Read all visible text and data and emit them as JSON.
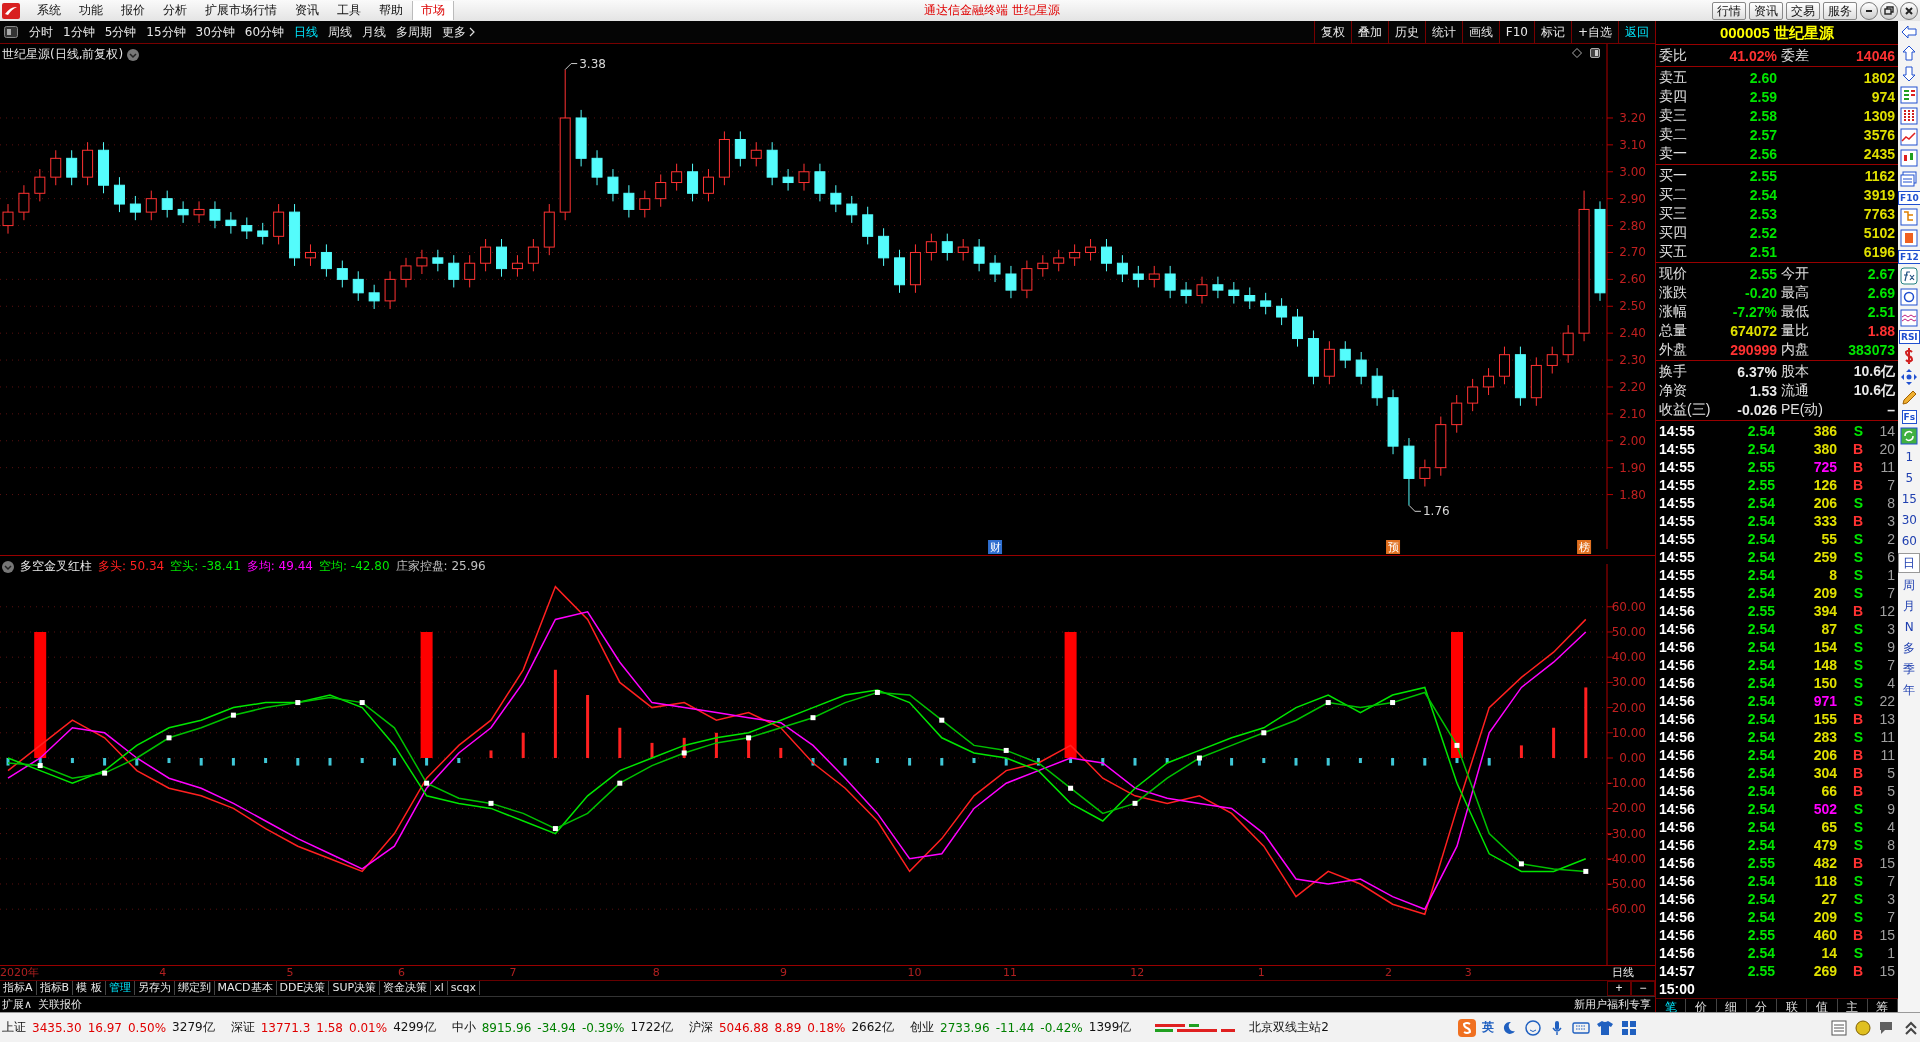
{
  "title_bar": {
    "menu": [
      {
        "label": "系统"
      },
      {
        "label": "功能"
      },
      {
        "label": "报价"
      },
      {
        "label": "分析"
      },
      {
        "label": "扩展市场行情"
      },
      {
        "label": "资讯"
      },
      {
        "label": "工具"
      },
      {
        "label": "帮助"
      }
    ],
    "market_tab": {
      "label": "市场",
      "selected": true
    },
    "title": "通达信金融终端  世纪星源",
    "buttons": [
      "行情",
      "资讯",
      "交易",
      "服务"
    ]
  },
  "toolbar": {
    "periods": [
      {
        "label": "分时",
        "selected": false
      },
      {
        "label": "1分钟",
        "selected": false
      },
      {
        "label": "5分钟",
        "selected": false
      },
      {
        "label": "15分钟",
        "selected": false
      },
      {
        "label": "30分钟",
        "selected": false
      },
      {
        "label": "60分钟",
        "selected": false
      },
      {
        "label": "日线",
        "selected": true
      },
      {
        "label": "周线",
        "selected": false
      },
      {
        "label": "月线",
        "selected": false
      },
      {
        "label": "多周期",
        "selected": false
      },
      {
        "label": "更多",
        "selected": false
      }
    ],
    "actions": [
      {
        "label": "复权",
        "accent": false
      },
      {
        "label": "叠加",
        "accent": false
      },
      {
        "label": "历史",
        "accent": false
      },
      {
        "label": "统计",
        "accent": false
      },
      {
        "label": "画线",
        "accent": false
      },
      {
        "label": "F10",
        "accent": false
      },
      {
        "label": "标记",
        "accent": false
      },
      {
        "label": "+自选",
        "accent": false
      },
      {
        "label": "返回",
        "accent": true
      }
    ]
  },
  "price_chart": {
    "title": "世纪星源(日线,前复权)",
    "markers": [
      {
        "label": "财",
        "color": "#2f6fd0"
      },
      {
        "label": "预",
        "color": "#e07020"
      },
      {
        "label": "榜",
        "color": "#e07020"
      }
    ],
    "axis_labels": [
      "2020年",
      "4",
      "5",
      "6",
      "7",
      "8",
      "9",
      "10",
      "11",
      "12",
      "1",
      "2",
      "3"
    ],
    "chart_data": {
      "type": "candlestick",
      "grid": true,
      "ylim": [
        1.598,
        3.475
      ],
      "yticks": [
        {
          "value": 3.2,
          "label": "3.20"
        },
        {
          "value": 3.1,
          "label": "3.10"
        },
        {
          "value": 3.0,
          "label": "3.00"
        },
        {
          "value": 2.9,
          "label": "2.90"
        },
        {
          "value": 2.8,
          "label": "2.80"
        },
        {
          "value": 2.7,
          "label": "2.70"
        },
        {
          "value": 2.6,
          "label": "2.60"
        },
        {
          "value": 2.5,
          "label": "2.50"
        },
        {
          "value": 2.4,
          "label": "2.40"
        },
        {
          "value": 2.3,
          "label": "2.30"
        },
        {
          "value": 2.2,
          "label": "2.20"
        },
        {
          "value": 2.1,
          "label": "2.10"
        },
        {
          "value": 2.0,
          "label": "2.00"
        },
        {
          "value": 1.9,
          "label": "1.90"
        },
        {
          "value": 1.8,
          "label": "1.80"
        }
      ],
      "annotations": [
        "3.38",
        "1.76"
      ],
      "ohlc": [
        [
          2.8,
          2.88,
          2.77,
          2.85
        ],
        [
          2.85,
          2.95,
          2.82,
          2.92
        ],
        [
          2.92,
          3.01,
          2.89,
          2.98
        ],
        [
          2.98,
          3.08,
          2.95,
          3.05
        ],
        [
          3.05,
          3.08,
          2.95,
          2.98
        ],
        [
          2.98,
          3.11,
          2.95,
          3.08
        ],
        [
          3.08,
          3.11,
          2.92,
          2.95
        ],
        [
          2.95,
          2.98,
          2.85,
          2.88
        ],
        [
          2.88,
          2.91,
          2.82,
          2.85
        ],
        [
          2.85,
          2.93,
          2.82,
          2.9
        ],
        [
          2.9,
          2.93,
          2.83,
          2.86
        ],
        [
          2.86,
          2.89,
          2.81,
          2.84
        ],
        [
          2.84,
          2.89,
          2.81,
          2.86
        ],
        [
          2.86,
          2.89,
          2.79,
          2.82
        ],
        [
          2.82,
          2.85,
          2.77,
          2.8
        ],
        [
          2.8,
          2.83,
          2.75,
          2.78
        ],
        [
          2.78,
          2.81,
          2.73,
          2.76
        ],
        [
          2.76,
          2.88,
          2.73,
          2.85
        ],
        [
          2.85,
          2.88,
          2.65,
          2.68
        ],
        [
          2.68,
          2.73,
          2.65,
          2.7
        ],
        [
          2.7,
          2.73,
          2.61,
          2.64
        ],
        [
          2.64,
          2.67,
          2.57,
          2.6
        ],
        [
          2.6,
          2.63,
          2.52,
          2.55
        ],
        [
          2.55,
          2.58,
          2.49,
          2.52
        ],
        [
          2.52,
          2.63,
          2.49,
          2.6
        ],
        [
          2.6,
          2.68,
          2.57,
          2.65
        ],
        [
          2.65,
          2.71,
          2.62,
          2.68
        ],
        [
          2.68,
          2.71,
          2.63,
          2.66
        ],
        [
          2.66,
          2.69,
          2.57,
          2.6
        ],
        [
          2.6,
          2.69,
          2.57,
          2.66
        ],
        [
          2.66,
          2.75,
          2.63,
          2.72
        ],
        [
          2.72,
          2.75,
          2.61,
          2.64
        ],
        [
          2.64,
          2.69,
          2.61,
          2.66
        ],
        [
          2.66,
          2.75,
          2.63,
          2.72
        ],
        [
          2.72,
          2.88,
          2.69,
          2.85
        ],
        [
          2.85,
          3.38,
          2.82,
          3.2
        ],
        [
          3.2,
          3.23,
          3.02,
          3.05
        ],
        [
          3.05,
          3.08,
          2.95,
          2.98
        ],
        [
          2.98,
          3.01,
          2.89,
          2.92
        ],
        [
          2.92,
          2.95,
          2.83,
          2.86
        ],
        [
          2.86,
          2.93,
          2.83,
          2.9
        ],
        [
          2.9,
          2.99,
          2.87,
          2.96
        ],
        [
          2.96,
          3.03,
          2.93,
          3.0
        ],
        [
          3.0,
          3.03,
          2.89,
          2.92
        ],
        [
          2.92,
          3.01,
          2.89,
          2.98
        ],
        [
          2.98,
          3.15,
          2.95,
          3.12
        ],
        [
          3.12,
          3.15,
          3.02,
          3.05
        ],
        [
          3.05,
          3.11,
          3.02,
          3.08
        ],
        [
          3.08,
          3.11,
          2.95,
          2.98
        ],
        [
          2.98,
          3.01,
          2.93,
          2.96
        ],
        [
          2.96,
          3.03,
          2.93,
          3.0
        ],
        [
          3.0,
          3.03,
          2.89,
          2.92
        ],
        [
          2.92,
          2.95,
          2.85,
          2.88
        ],
        [
          2.88,
          2.91,
          2.81,
          2.84
        ],
        [
          2.84,
          2.87,
          2.73,
          2.76
        ],
        [
          2.76,
          2.79,
          2.65,
          2.68
        ],
        [
          2.68,
          2.71,
          2.55,
          2.58
        ],
        [
          2.58,
          2.73,
          2.55,
          2.7
        ],
        [
          2.7,
          2.77,
          2.67,
          2.74
        ],
        [
          2.74,
          2.77,
          2.67,
          2.7
        ],
        [
          2.7,
          2.75,
          2.67,
          2.72
        ],
        [
          2.72,
          2.75,
          2.63,
          2.66
        ],
        [
          2.66,
          2.69,
          2.59,
          2.62
        ],
        [
          2.62,
          2.65,
          2.53,
          2.56
        ],
        [
          2.56,
          2.67,
          2.53,
          2.64
        ],
        [
          2.64,
          2.69,
          2.61,
          2.66
        ],
        [
          2.66,
          2.71,
          2.63,
          2.68
        ],
        [
          2.68,
          2.73,
          2.65,
          2.7
        ],
        [
          2.7,
          2.75,
          2.67,
          2.72
        ],
        [
          2.72,
          2.75,
          2.63,
          2.66
        ],
        [
          2.66,
          2.69,
          2.59,
          2.62
        ],
        [
          2.62,
          2.65,
          2.57,
          2.6
        ],
        [
          2.6,
          2.65,
          2.57,
          2.62
        ],
        [
          2.62,
          2.65,
          2.53,
          2.56
        ],
        [
          2.56,
          2.59,
          2.51,
          2.54
        ],
        [
          2.54,
          2.61,
          2.51,
          2.58
        ],
        [
          2.58,
          2.61,
          2.53,
          2.56
        ],
        [
          2.56,
          2.59,
          2.51,
          2.54
        ],
        [
          2.54,
          2.57,
          2.49,
          2.52
        ],
        [
          2.52,
          2.55,
          2.47,
          2.5
        ],
        [
          2.5,
          2.53,
          2.43,
          2.46
        ],
        [
          2.46,
          2.49,
          2.35,
          2.38
        ],
        [
          2.38,
          2.41,
          2.21,
          2.24
        ],
        [
          2.24,
          2.37,
          2.21,
          2.34
        ],
        [
          2.34,
          2.37,
          2.27,
          2.3
        ],
        [
          2.3,
          2.33,
          2.21,
          2.24
        ],
        [
          2.24,
          2.27,
          2.13,
          2.16
        ],
        [
          2.16,
          2.19,
          1.95,
          1.98
        ],
        [
          1.98,
          2.01,
          1.76,
          1.86
        ],
        [
          1.86,
          1.93,
          1.83,
          1.9
        ],
        [
          1.9,
          2.09,
          1.87,
          2.06
        ],
        [
          2.06,
          2.17,
          2.03,
          2.14
        ],
        [
          2.14,
          2.23,
          2.11,
          2.2
        ],
        [
          2.2,
          2.27,
          2.17,
          2.24
        ],
        [
          2.24,
          2.35,
          2.21,
          2.32
        ],
        [
          2.32,
          2.35,
          2.13,
          2.16
        ],
        [
          2.16,
          2.31,
          2.13,
          2.28
        ],
        [
          2.28,
          2.35,
          2.25,
          2.32
        ],
        [
          2.32,
          2.43,
          2.29,
          2.4
        ],
        [
          2.4,
          2.93,
          2.37,
          2.86
        ],
        [
          2.86,
          2.89,
          2.52,
          2.55
        ]
      ]
    }
  },
  "indicator": {
    "title": "多空金叉红柱",
    "readouts": [
      {
        "label": "多头:",
        "value": "50.34",
        "color": "#ff2020"
      },
      {
        "label": "空头:",
        "value": "-38.41",
        "color": "#00e600"
      },
      {
        "label": "多均:",
        "value": "49.44",
        "color": "#ff00ff"
      },
      {
        "label": "空均:",
        "value": "-42.80",
        "color": "#00e600"
      },
      {
        "label": "庄家控盘:",
        "value": "25.96",
        "color": "#c0c0c0"
      }
    ],
    "chart_data": {
      "type": "line",
      "grid": true,
      "ylim": [
        -82.54,
        76.98
      ],
      "yticks": [
        {
          "value": 60,
          "label": "60.00"
        },
        {
          "value": 50,
          "label": "50.00"
        },
        {
          "value": 40,
          "label": "40.00"
        },
        {
          "value": 30,
          "label": "30.00"
        },
        {
          "value": 20,
          "label": "20.00"
        },
        {
          "value": 10,
          "label": "10.00"
        },
        {
          "value": 0,
          "label": "0.00"
        },
        {
          "value": -10,
          "label": "-10.00"
        },
        {
          "value": -20,
          "label": "-20.00"
        },
        {
          "value": -30,
          "label": "-30.00"
        },
        {
          "value": -40,
          "label": "-40.00"
        },
        {
          "value": -50,
          "label": "-50.00"
        },
        {
          "value": -60,
          "label": "-60.00"
        }
      ],
      "series": [
        {
          "type": "bar",
          "color": "#ff0000",
          "values": [
            null,
            50,
            null,
            null,
            null,
            null,
            null,
            null,
            null,
            null,
            null,
            null,
            null,
            50,
            null,
            null,
            null,
            null,
            null,
            null,
            null,
            null,
            null,
            null,
            null,
            null,
            null,
            null,
            null,
            null,
            null,
            null,
            null,
            50,
            null,
            null,
            null,
            null,
            null,
            null,
            null,
            null,
            null,
            null,
            null,
            50,
            null,
            null,
            null,
            null
          ]
        },
        {
          "type": "bar",
          "color": "#ff2020",
          "values": [
            null,
            null,
            null,
            null,
            null,
            null,
            null,
            null,
            null,
            null,
            null,
            null,
            null,
            null,
            null,
            3,
            10,
            35,
            25,
            12,
            6,
            8,
            10,
            8,
            4,
            null,
            null,
            null,
            null,
            null,
            null,
            null,
            null,
            null,
            null,
            null,
            null,
            null,
            null,
            null,
            null,
            null,
            null,
            null,
            null,
            null,
            null,
            5,
            12,
            28
          ]
        },
        {
          "type": "bar",
          "color": "#40c8d8",
          "values": [
            -3,
            -3,
            -2,
            -3,
            -3,
            -2,
            -3,
            -3,
            -2,
            -3,
            -3,
            -2,
            -3,
            -3,
            -2,
            null,
            null,
            null,
            null,
            null,
            null,
            null,
            null,
            null,
            null,
            -3,
            -3,
            -2,
            -3,
            -3,
            -2,
            -3,
            -3,
            -2,
            -3,
            -3,
            -2,
            -3,
            -3,
            -2,
            -3,
            -3,
            -2,
            -3,
            -3,
            -2,
            -3,
            null,
            null,
            null
          ]
        },
        {
          "type": "line",
          "color": "#ff2020",
          "values": [
            -5,
            5,
            15,
            8,
            -5,
            -12,
            -15,
            -20,
            -28,
            -35,
            -40,
            -45,
            -30,
            -8,
            5,
            15,
            35,
            68,
            55,
            30,
            20,
            22,
            15,
            18,
            12,
            -2,
            -12,
            -25,
            -45,
            -32,
            -15,
            -5,
            -2,
            5,
            -8,
            -15,
            -18,
            -15,
            -22,
            -35,
            -55,
            -45,
            -50,
            -58,
            -62,
            -20,
            20,
            32,
            42,
            55
          ]
        },
        {
          "type": "line",
          "color": "#ff00ff",
          "values": [
            -8,
            0,
            12,
            10,
            0,
            -8,
            -12,
            -18,
            -25,
            -32,
            -38,
            -44,
            -35,
            -12,
            2,
            12,
            30,
            55,
            58,
            38,
            22,
            20,
            18,
            16,
            14,
            5,
            -8,
            -22,
            -40,
            -38,
            -20,
            -10,
            -5,
            0,
            -2,
            -12,
            -16,
            -18,
            -20,
            -30,
            -48,
            -50,
            -48,
            -55,
            -60,
            -35,
            10,
            28,
            38,
            50
          ]
        },
        {
          "type": "line",
          "color": "#00e600",
          "values": [
            0,
            -5,
            -10,
            -5,
            5,
            12,
            15,
            20,
            22,
            22,
            25,
            20,
            5,
            -15,
            -18,
            -20,
            -25,
            -30,
            -15,
            -5,
            0,
            5,
            8,
            10,
            15,
            20,
            25,
            27,
            22,
            8,
            2,
            0,
            -5,
            -18,
            -25,
            -12,
            -2,
            3,
            8,
            12,
            20,
            25,
            18,
            25,
            28,
            -10,
            -38,
            -45,
            -45,
            -40
          ]
        },
        {
          "type": "line",
          "color": "#00c000",
          "values": [
            -2,
            -3,
            -8,
            -6,
            0,
            8,
            12,
            17,
            20,
            22,
            24,
            22,
            12,
            -10,
            -16,
            -18,
            -22,
            -28,
            -22,
            -10,
            -3,
            2,
            6,
            8,
            12,
            16,
            22,
            26,
            25,
            15,
            5,
            3,
            -2,
            -12,
            -22,
            -18,
            -8,
            0,
            5,
            10,
            15,
            22,
            20,
            22,
            26,
            5,
            -30,
            -42,
            -44,
            -45
          ]
        }
      ]
    }
  },
  "bottom_tools": {
    "items": [
      {
        "label": "指标A",
        "selected": false
      },
      {
        "label": "指标B",
        "selected": false
      },
      {
        "label": "模 板",
        "selected": false
      },
      {
        "label": "管理",
        "selected": true
      },
      {
        "label": "另存为",
        "selected": false
      },
      {
        "label": "绑定到",
        "selected": false
      },
      {
        "label": "MACD基本",
        "selected": false
      },
      {
        "label": "DDE决策",
        "selected": false
      },
      {
        "label": "SUP决策",
        "selected": false
      },
      {
        "label": "资金决策",
        "selected": false
      },
      {
        "label": "xl",
        "selected": false
      },
      {
        "label": "scqx",
        "selected": false
      }
    ],
    "period_label": "日线",
    "zoom_in": "+",
    "zoom_out": "−"
  },
  "expand_row": {
    "expand": "扩展∧",
    "linked": "关联报价",
    "promo": "新用户福利专享"
  },
  "quote": {
    "code": "000005",
    "name": "世纪星源",
    "ratio": [
      {
        "label": "委比",
        "value": "41.02%",
        "color": "#ff3232"
      },
      {
        "label": "委差",
        "value": "14046",
        "color": "#ff3232"
      }
    ],
    "asks": [
      {
        "label": "卖五",
        "price": "2.60",
        "volume": "1802"
      },
      {
        "label": "卖四",
        "price": "2.59",
        "volume": "974"
      },
      {
        "label": "卖三",
        "price": "2.58",
        "volume": "1309"
      },
      {
        "label": "卖二",
        "price": "2.57",
        "volume": "3576"
      },
      {
        "label": "卖一",
        "price": "2.56",
        "volume": "2435"
      }
    ],
    "bids": [
      {
        "label": "买一",
        "price": "2.55",
        "volume": "1162"
      },
      {
        "label": "买二",
        "price": "2.54",
        "volume": "3919"
      },
      {
        "label": "买三",
        "price": "2.53",
        "volume": "7763"
      },
      {
        "label": "买四",
        "price": "2.52",
        "volume": "5102"
      },
      {
        "label": "买五",
        "price": "2.51",
        "volume": "6196"
      }
    ],
    "stats": [
      [
        {
          "cells": [
            {
              "label": "现价",
              "value": "2.55",
              "color": "#00e600"
            },
            {
              "label": "今开",
              "value": "2.67",
              "color": "#00e600"
            }
          ]
        },
        {
          "cells": [
            {
              "label": "涨跌",
              "value": "-0.20",
              "color": "#00e600"
            },
            {
              "label": "最高",
              "value": "2.69",
              "color": "#00e600"
            }
          ]
        },
        {
          "cells": [
            {
              "label": "涨幅",
              "value": "-7.27%",
              "color": "#00e600"
            },
            {
              "label": "最低",
              "value": "2.51",
              "color": "#00e600"
            }
          ]
        },
        {
          "cells": [
            {
              "label": "总量",
              "value": "674072",
              "color": "#e0e000"
            },
            {
              "label": "量比",
              "value": "1.88",
              "color": "#ff3232"
            }
          ]
        },
        {
          "cells": [
            {
              "label": "外盘",
              "value": "290999",
              "color": "#ff3232"
            },
            {
              "label": "内盘",
              "value": "383073",
              "color": "#00e600"
            }
          ]
        }
      ],
      [
        {
          "cells": [
            {
              "label": "换手",
              "value": "6.37%",
              "color": "#e8e8e8"
            },
            {
              "label": "股本",
              "value": "10.6亿",
              "color": "#e8e8e8"
            }
          ]
        },
        {
          "cells": [
            {
              "label": "净资",
              "value": "1.53",
              "color": "#e8e8e8"
            },
            {
              "label": "流通",
              "value": "10.6亿",
              "color": "#e8e8e8"
            }
          ]
        },
        {
          "cells": [
            {
              "label": "收益(三)",
              "value": "-0.026",
              "color": "#e8e8e8"
            },
            {
              "label": "PE(动)",
              "value": "–",
              "color": "#e8e8e8"
            }
          ]
        }
      ]
    ]
  },
  "trades": [
    {
      "time": "14:55",
      "price": "2.54",
      "volume": "386",
      "big": false,
      "side": "S",
      "kind": "sell",
      "count": "14"
    },
    {
      "time": "14:55",
      "price": "2.54",
      "volume": "380",
      "big": false,
      "side": "B",
      "kind": "buy",
      "count": "20"
    },
    {
      "time": "14:55",
      "price": "2.55",
      "volume": "725",
      "big": true,
      "side": "B",
      "kind": "buy",
      "count": "11"
    },
    {
      "time": "14:55",
      "price": "2.55",
      "volume": "126",
      "big": false,
      "side": "B",
      "kind": "buy",
      "count": "7"
    },
    {
      "time": "14:55",
      "price": "2.54",
      "volume": "206",
      "big": false,
      "side": "S",
      "kind": "sell",
      "count": "8"
    },
    {
      "time": "14:55",
      "price": "2.54",
      "volume": "333",
      "big": false,
      "side": "B",
      "kind": "buy",
      "count": "3"
    },
    {
      "time": "14:55",
      "price": "2.54",
      "volume": "55",
      "big": false,
      "side": "S",
      "kind": "sell",
      "count": "2"
    },
    {
      "time": "14:55",
      "price": "2.54",
      "volume": "259",
      "big": false,
      "side": "S",
      "kind": "sell",
      "count": "6"
    },
    {
      "time": "14:55",
      "price": "2.54",
      "volume": "8",
      "big": false,
      "side": "S",
      "kind": "sell",
      "count": "1"
    },
    {
      "time": "14:55",
      "price": "2.54",
      "volume": "209",
      "big": false,
      "side": "S",
      "kind": "sell",
      "count": "7"
    },
    {
      "time": "14:56",
      "price": "2.55",
      "volume": "394",
      "big": false,
      "side": "B",
      "kind": "buy",
      "count": "12"
    },
    {
      "time": "14:56",
      "price": "2.54",
      "volume": "87",
      "big": false,
      "side": "S",
      "kind": "sell",
      "count": "3"
    },
    {
      "time": "14:56",
      "price": "2.54",
      "volume": "154",
      "big": false,
      "side": "S",
      "kind": "sell",
      "count": "9"
    },
    {
      "time": "14:56",
      "price": "2.54",
      "volume": "148",
      "big": false,
      "side": "S",
      "kind": "sell",
      "count": "7"
    },
    {
      "time": "14:56",
      "price": "2.54",
      "volume": "150",
      "big": false,
      "side": "S",
      "kind": "sell",
      "count": "4"
    },
    {
      "time": "14:56",
      "price": "2.54",
      "volume": "971",
      "big": true,
      "side": "S",
      "kind": "sell",
      "count": "22"
    },
    {
      "time": "14:56",
      "price": "2.54",
      "volume": "155",
      "big": false,
      "side": "B",
      "kind": "buy",
      "count": "13"
    },
    {
      "time": "14:56",
      "price": "2.54",
      "volume": "283",
      "big": false,
      "side": "S",
      "kind": "sell",
      "count": "11"
    },
    {
      "time": "14:56",
      "price": "2.54",
      "volume": "206",
      "big": false,
      "side": "B",
      "kind": "buy",
      "count": "11"
    },
    {
      "time": "14:56",
      "price": "2.54",
      "volume": "304",
      "big": false,
      "side": "B",
      "kind": "buy",
      "count": "5"
    },
    {
      "time": "14:56",
      "price": "2.54",
      "volume": "66",
      "big": false,
      "side": "B",
      "kind": "buy",
      "count": "5"
    },
    {
      "time": "14:56",
      "price": "2.54",
      "volume": "502",
      "big": true,
      "side": "S",
      "kind": "sell",
      "count": "9"
    },
    {
      "time": "14:56",
      "price": "2.54",
      "volume": "65",
      "big": false,
      "side": "S",
      "kind": "sell",
      "count": "4"
    },
    {
      "time": "14:56",
      "price": "2.54",
      "volume": "479",
      "big": false,
      "side": "S",
      "kind": "sell",
      "count": "8"
    },
    {
      "time": "14:56",
      "price": "2.55",
      "volume": "482",
      "big": false,
      "side": "B",
      "kind": "buy",
      "count": "15"
    },
    {
      "time": "14:56",
      "price": "2.54",
      "volume": "118",
      "big": false,
      "side": "S",
      "kind": "sell",
      "count": "7"
    },
    {
      "time": "14:56",
      "price": "2.54",
      "volume": "27",
      "big": false,
      "side": "S",
      "kind": "sell",
      "count": "3"
    },
    {
      "time": "14:56",
      "price": "2.54",
      "volume": "209",
      "big": false,
      "side": "S",
      "kind": "sell",
      "count": "7"
    },
    {
      "time": "14:56",
      "price": "2.55",
      "volume": "460",
      "big": false,
      "side": "B",
      "kind": "buy",
      "count": "15"
    },
    {
      "time": "14:56",
      "price": "2.54",
      "volume": "14",
      "big": false,
      "side": "S",
      "kind": "sell",
      "count": "1"
    },
    {
      "time": "14:57",
      "price": "2.55",
      "volume": "269",
      "big": false,
      "side": "B",
      "kind": "buy",
      "count": "15"
    },
    {
      "time": "15:00"
    }
  ],
  "detail_tabs": [
    {
      "label": "笔",
      "selected": true
    },
    {
      "label": "价",
      "selected": false
    },
    {
      "label": "细",
      "selected": false
    },
    {
      "label": "分",
      "selected": false
    },
    {
      "label": "联",
      "selected": false
    },
    {
      "label": "值",
      "selected": false
    },
    {
      "label": "主",
      "selected": false
    },
    {
      "label": "筹",
      "selected": false
    }
  ],
  "sidebar": {
    "tools": [
      {
        "kind": "arrow-left"
      },
      {
        "kind": "arrow-up"
      },
      {
        "kind": "arrow-down"
      },
      {
        "kind": "table"
      },
      {
        "kind": "bars"
      },
      {
        "kind": "line"
      },
      {
        "kind": "candles"
      },
      {
        "kind": "cards"
      },
      {
        "kind": "text",
        "label": "F10"
      },
      {
        "kind": "tree"
      },
      {
        "kind": "page"
      },
      {
        "kind": "text",
        "label": "F12"
      },
      {
        "kind": "fx"
      },
      {
        "kind": "circle"
      },
      {
        "kind": "wave"
      },
      {
        "kind": "text",
        "label": "RSI"
      },
      {
        "kind": "dollar"
      },
      {
        "kind": "move"
      },
      {
        "kind": "pencil"
      },
      {
        "kind": "text",
        "label": "Fs"
      },
      {
        "kind": "refresh"
      }
    ],
    "periods": [
      {
        "label": "1",
        "selected": false
      },
      {
        "label": "5",
        "selected": false
      },
      {
        "label": "15",
        "selected": false
      },
      {
        "label": "30",
        "selected": false
      },
      {
        "label": "60",
        "selected": false
      },
      {
        "label": "日",
        "selected": true
      },
      {
        "label": "周",
        "selected": false
      },
      {
        "label": "月",
        "selected": false
      },
      {
        "label": "N",
        "selected": false
      },
      {
        "label": "多",
        "selected": false
      },
      {
        "label": "季",
        "selected": false
      },
      {
        "label": "年",
        "selected": false
      }
    ]
  },
  "status_bar": {
    "indices": [
      {
        "name": "上证",
        "value": "3435.30",
        "change": "16.97",
        "pct": "0.50%",
        "amount": "3279亿",
        "kind": "up"
      },
      {
        "name": "深证",
        "value": "13771.3",
        "change": "1.58",
        "pct": "0.01%",
        "amount": "4299亿",
        "kind": "up"
      },
      {
        "name": "中小",
        "value": "8915.96",
        "change": "-34.94",
        "pct": "-0.39%",
        "amount": "1722亿",
        "kind": "down"
      },
      {
        "name": "沪深",
        "value": "5046.88",
        "change": "8.89",
        "pct": "0.18%",
        "amount": "2662亿",
        "kind": "up"
      },
      {
        "name": "创业",
        "value": "2733.96",
        "change": "-11.44",
        "pct": "-0.42%",
        "amount": "1399亿",
        "kind": "down"
      }
    ],
    "server": "北京双线主站2",
    "ime": "英"
  }
}
